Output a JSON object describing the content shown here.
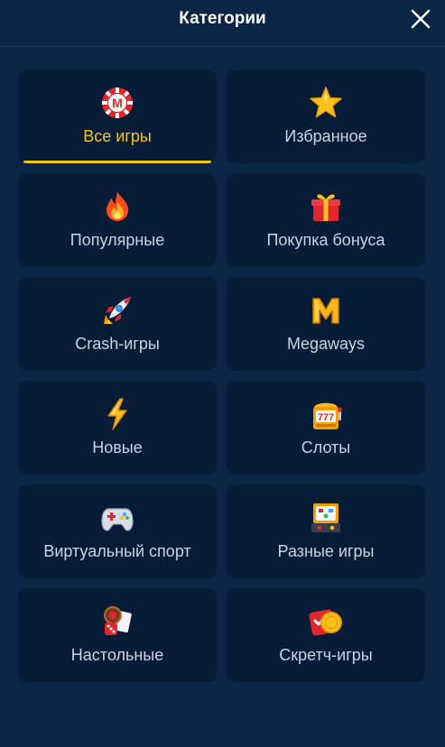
{
  "header": {
    "title": "Категории",
    "close_icon": "close-icon"
  },
  "categories": [
    {
      "label": "Все игры",
      "icon": "casino-chip-icon",
      "active": true
    },
    {
      "label": "Избранное",
      "icon": "star-icon",
      "active": false
    },
    {
      "label": "Популярные",
      "icon": "fire-icon",
      "active": false
    },
    {
      "label": "Покупка бонуса",
      "icon": "gift-icon",
      "active": false
    },
    {
      "label": "Crash-игры",
      "icon": "rocket-icon",
      "active": false
    },
    {
      "label": "Megaways",
      "icon": "letter-m-icon",
      "active": false
    },
    {
      "label": "Новые",
      "icon": "lightning-icon",
      "active": false
    },
    {
      "label": "Слоты",
      "icon": "slot-machine-icon",
      "active": false
    },
    {
      "label": "Виртуальный спорт",
      "icon": "gamepad-icon",
      "active": false
    },
    {
      "label": "Разные игры",
      "icon": "arcade-machine-icon",
      "active": false
    },
    {
      "label": "Настольные",
      "icon": "dice-cards-icon",
      "active": false
    },
    {
      "label": "Скретч-игры",
      "icon": "scratch-card-icon",
      "active": false
    }
  ],
  "colors": {
    "background": "#0a2545",
    "tile": "#071d37",
    "accent": "#f5c518",
    "text": "#c9d3e2"
  }
}
